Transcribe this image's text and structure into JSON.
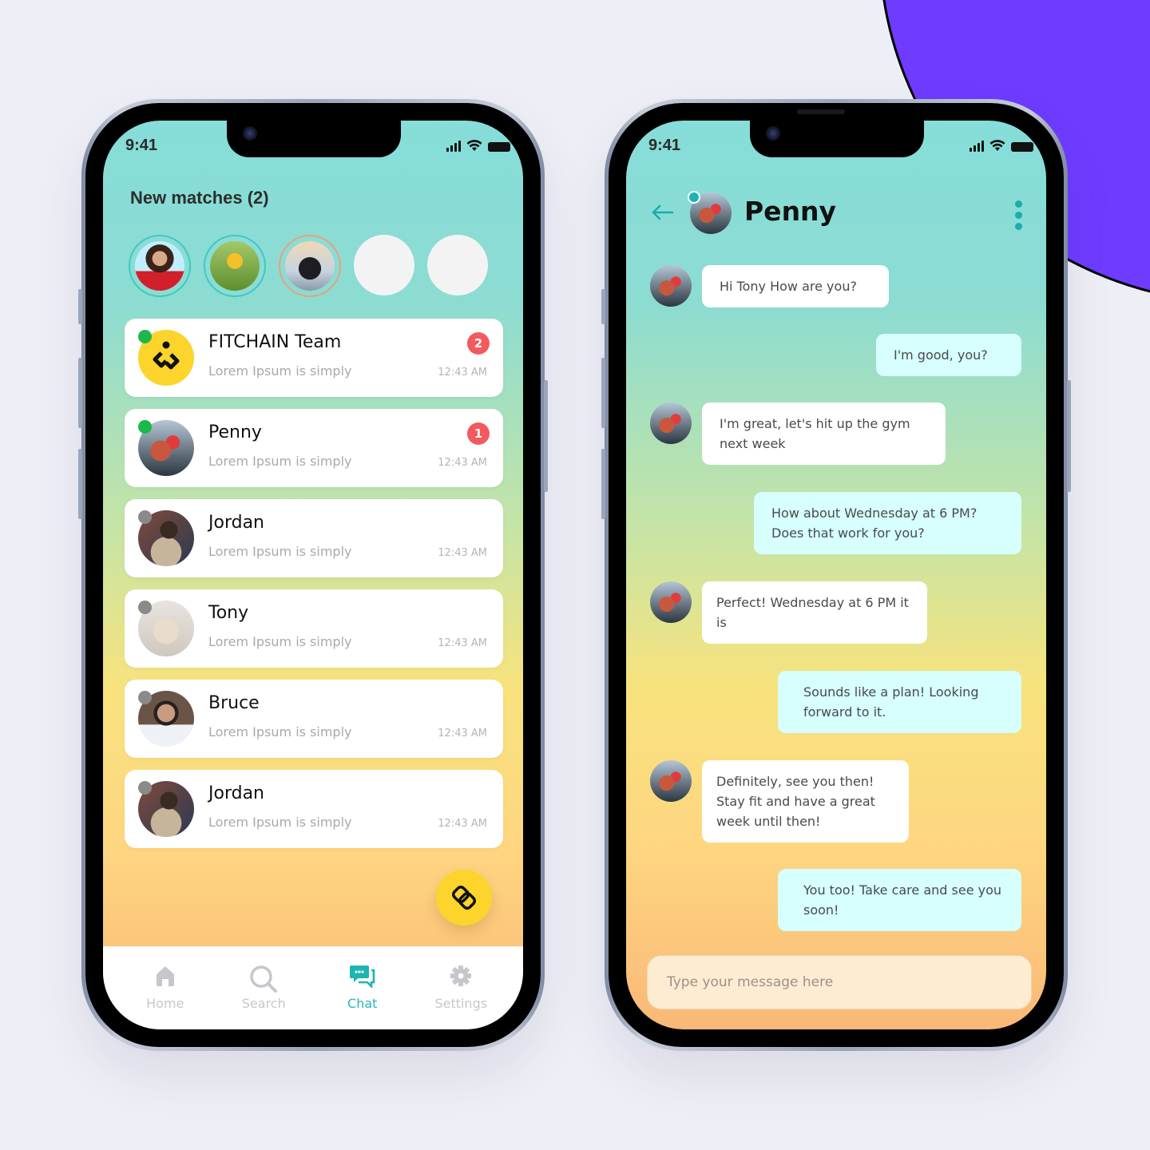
{
  "background": {
    "accent": "#6e3bff"
  },
  "list_screen": {
    "status_time": "9:41",
    "matches_title": "New matches (2)",
    "matches": [
      {
        "name": "match-1",
        "ring": "teal"
      },
      {
        "name": "match-2",
        "ring": "teal"
      },
      {
        "name": "match-3",
        "ring": "orange"
      },
      {
        "name": "match-empty-1",
        "ring": "none"
      },
      {
        "name": "match-empty-2",
        "ring": "none"
      }
    ],
    "chats": [
      {
        "name": "FITCHAIN Team",
        "preview": "Lorem Ipsum is simply",
        "time": "12:43 AM",
        "unread": "2",
        "online": true
      },
      {
        "name": "Penny",
        "preview": "Lorem Ipsum is simply",
        "time": "12:43 AM",
        "unread": "1",
        "online": true
      },
      {
        "name": "Jordan",
        "preview": "Lorem Ipsum is simply",
        "time": "12:43 AM",
        "unread": null,
        "online": false
      },
      {
        "name": "Tony",
        "preview": "Lorem Ipsum is simply",
        "time": "12:43 AM",
        "unread": null,
        "online": false
      },
      {
        "name": "Bruce",
        "preview": "Lorem Ipsum is simply",
        "time": "12:43 AM",
        "unread": null,
        "online": false
      },
      {
        "name": "Jordan",
        "preview": "Lorem Ipsum is simply",
        "time": "12:43 AM",
        "unread": null,
        "online": false
      }
    ],
    "tabs": [
      {
        "label": "Home",
        "icon": "home-icon",
        "active": false
      },
      {
        "label": "Search",
        "icon": "search-icon",
        "active": false
      },
      {
        "label": "Chat",
        "icon": "chat-icon",
        "active": true
      },
      {
        "label": "Settings",
        "icon": "gear-icon",
        "active": false
      }
    ],
    "colors": {
      "online": "#1cb84a",
      "offline": "#8a8a8a",
      "badge": "#f25a5e",
      "active_tab": "#26b8b6",
      "fab": "#fcd42b"
    }
  },
  "chat_screen": {
    "status_time": "9:41",
    "contact_name": "Penny",
    "messages": [
      {
        "from": "them",
        "text": "Hi Tony How are you?"
      },
      {
        "from": "me",
        "text": "I'm good, you?"
      },
      {
        "from": "them",
        "text": "I'm great, let's hit up the gym next week"
      },
      {
        "from": "me",
        "text": "How about Wednesday at 6 PM? Does that work for you?"
      },
      {
        "from": "them",
        "text": "Perfect! Wednesday at 6 PM it is"
      },
      {
        "from": "me",
        "text": "Sounds like a plan! Looking forward to it."
      },
      {
        "from": "them",
        "text": "Definitely, see you then! Stay fit and have a great week until then!"
      },
      {
        "from": "me",
        "text": "You too! Take care and see you soon!"
      }
    ],
    "input_placeholder": "Type your message here",
    "colors": {
      "incoming_bubble": "#ffffff",
      "outgoing_bubble": "#d6fffd",
      "accent": "#1aadaa"
    }
  }
}
